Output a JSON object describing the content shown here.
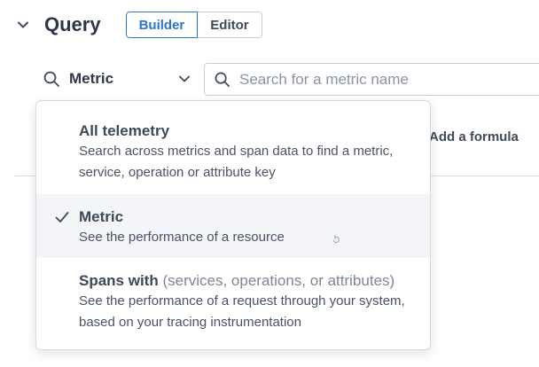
{
  "header": {
    "title": "Query",
    "mode_tabs": [
      {
        "label": "Builder",
        "active": true
      },
      {
        "label": "Editor",
        "active": false
      }
    ]
  },
  "query_type": {
    "selected": "Metric",
    "icon": "search-icon"
  },
  "search": {
    "placeholder": "Search for a metric name",
    "value": ""
  },
  "actions": {
    "add_formula": "Add a formula"
  },
  "dropdown": {
    "options": [
      {
        "title": "All telemetry",
        "title_suffix": "",
        "description": "Search across metrics and span data to find a metric, service, operation or attribute key",
        "selected": false
      },
      {
        "title": "Metric",
        "title_suffix": "",
        "description": "See the performance of a resource",
        "selected": true
      },
      {
        "title": "Spans with",
        "title_suffix": "(services, operations, or attributes)",
        "description": "See the performance of a request through your system, based on your tracing instrumentation",
        "selected": false
      }
    ]
  },
  "colors": {
    "accent": "#2a78c6",
    "text": "#2f3a4b",
    "selected_bg": "#f3f5f8"
  }
}
